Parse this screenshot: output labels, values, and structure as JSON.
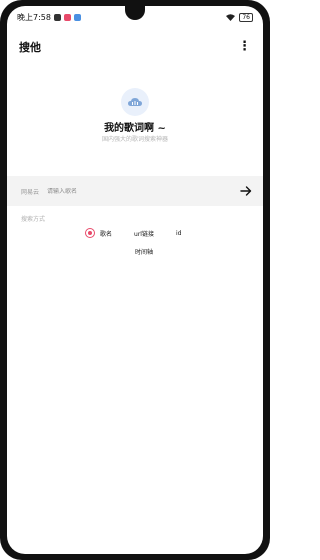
{
  "status": {
    "time": "晚上7:58",
    "battery": "76"
  },
  "appbar": {
    "title": "搜他"
  },
  "hero": {
    "title": "我的歌词啊 ~",
    "subtitle": "国内强大的歌词搜索神器"
  },
  "search": {
    "prefix": "网易云",
    "placeholder": "请输入歌名"
  },
  "options": {
    "section_label": "搜索方式",
    "items": [
      "歌名",
      "url链接",
      "id"
    ],
    "selected": "歌名",
    "extra": "时间轴"
  },
  "colors": {
    "accent": "#e84a6a",
    "hero_icon_bg": "#e9f0fb",
    "hero_icon": "#7fa6d8"
  }
}
